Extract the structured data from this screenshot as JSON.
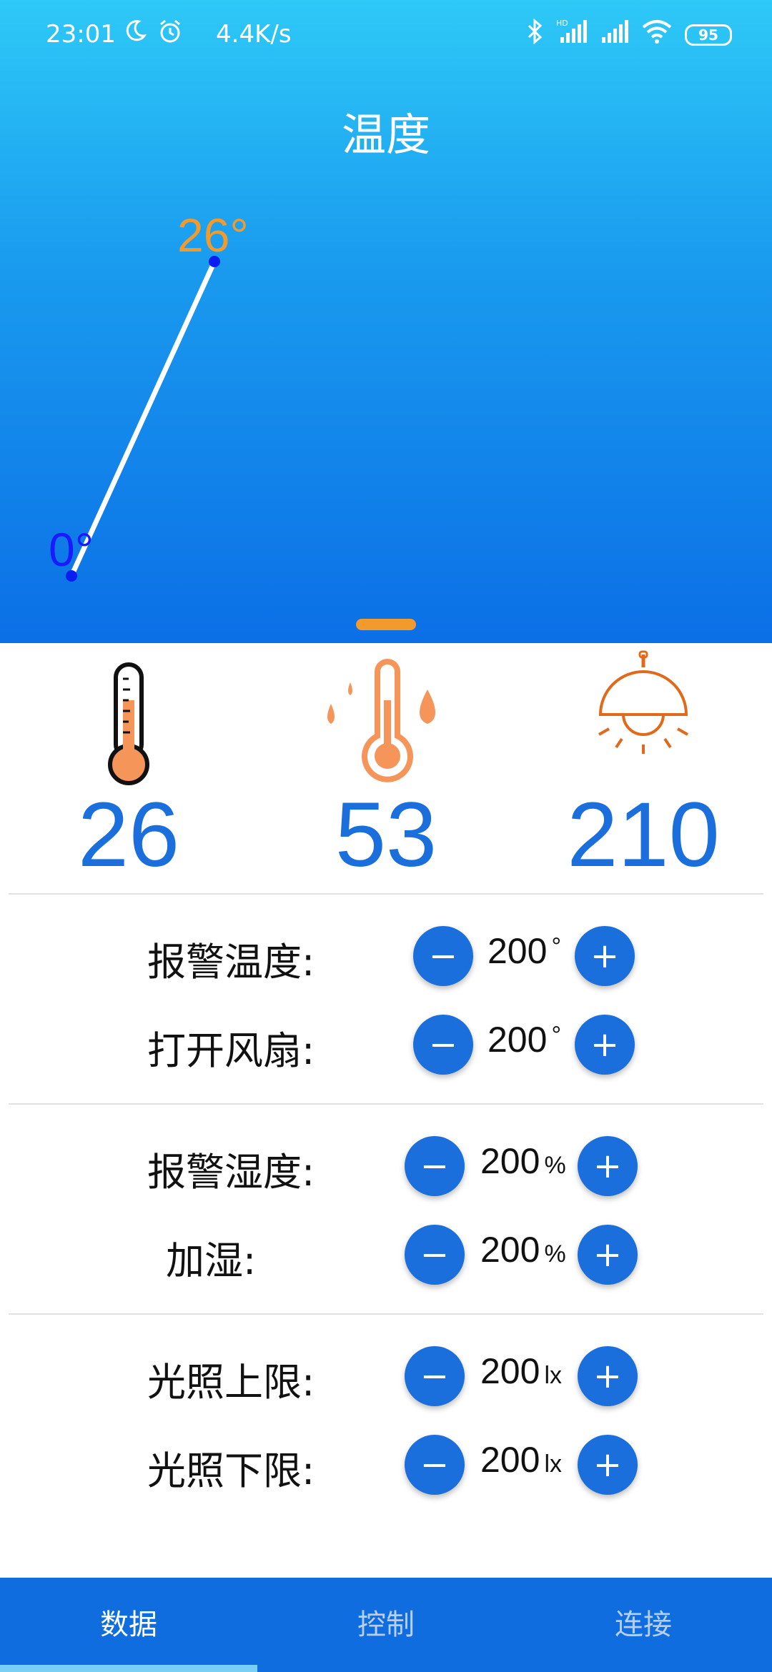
{
  "status_bar": {
    "time": "23:01",
    "moon_icon": "moon-icon",
    "alarm_icon": "alarm-icon",
    "net_speed": "4.4K/s",
    "hd_label": "HD",
    "battery": "95"
  },
  "header": {
    "title": "温度",
    "point_labels": {
      "start": "0°",
      "end": "26°"
    }
  },
  "chart_data": {
    "type": "line",
    "title": "温度",
    "x": [
      0,
      1
    ],
    "values": [
      0,
      26
    ],
    "point_labels": [
      "0°",
      "26°"
    ],
    "ylim": [
      0,
      26
    ],
    "colors": {
      "line": "#ffffff",
      "start": "#1a1aff",
      "end": "#f39a2c"
    }
  },
  "sensors": [
    {
      "icon": "thermometer-icon",
      "value": "26"
    },
    {
      "icon": "humidity-thermometer-icon",
      "value": "53"
    },
    {
      "icon": "lamp-icon",
      "value": "210"
    }
  ],
  "settings": {
    "alarm_temp": {
      "label": "报警温度:",
      "value": "200",
      "unit": "°"
    },
    "fan_on": {
      "label": "打开风扇:",
      "value": "200",
      "unit": "°"
    },
    "alarm_humidity": {
      "label": "报警湿度:",
      "value": "200",
      "unit": "%"
    },
    "humidify": {
      "label": "加湿:",
      "value": "200",
      "unit": "%"
    },
    "light_upper": {
      "label": "光照上限:",
      "value": "200",
      "unit": "lx"
    },
    "light_lower": {
      "label": "光照下限:",
      "value": "200",
      "unit": "lx"
    }
  },
  "buttons": {
    "minus": "−",
    "plus": "+"
  },
  "nav": {
    "tabs": [
      {
        "label": "数据",
        "active": true
      },
      {
        "label": "控制",
        "active": false
      },
      {
        "label": "连接",
        "active": false
      }
    ]
  },
  "colors": {
    "accent": "#1a6fdd",
    "header_top": "#2ec9f7",
    "header_bottom": "#0b6fe6",
    "orange": "#f39a2c"
  }
}
